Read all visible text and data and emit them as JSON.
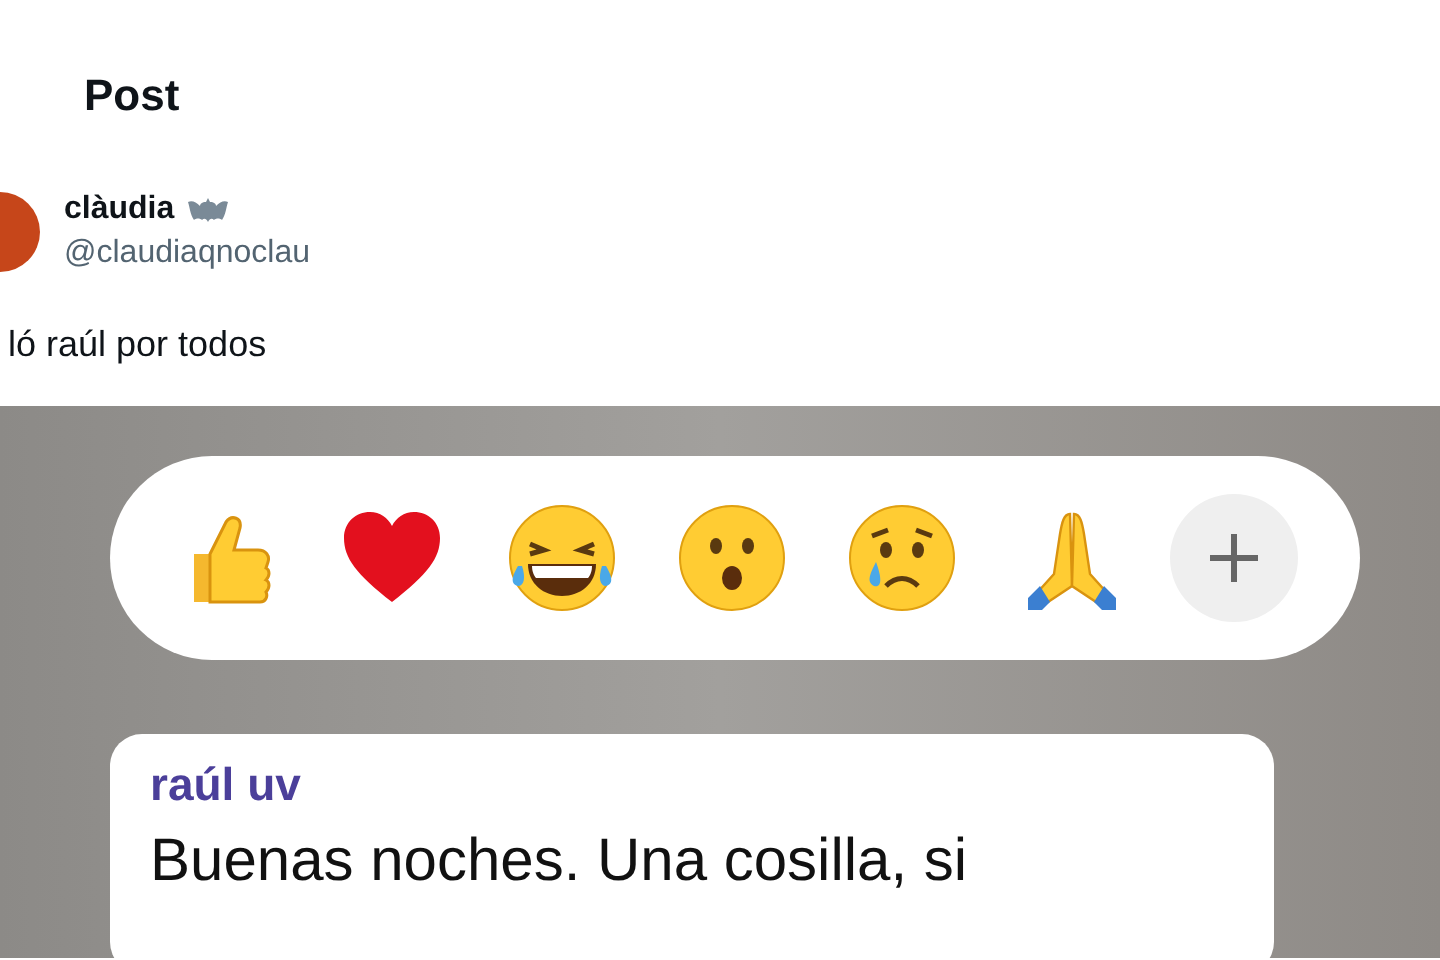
{
  "page": {
    "title": "Post"
  },
  "post": {
    "author": {
      "name": "clàudia",
      "handle": "@claudiaqnoclau"
    },
    "text": "ló raúl por todos",
    "image": {
      "reactions": [
        {
          "kind": "thumbs_up"
        },
        {
          "kind": "heart"
        },
        {
          "kind": "laughing"
        },
        {
          "kind": "surprised"
        },
        {
          "kind": "crying"
        },
        {
          "kind": "praying"
        },
        {
          "kind": "add"
        }
      ],
      "message": {
        "sender": "raúl uv",
        "text": "Buenas noches. Una cosilla, si"
      }
    }
  }
}
